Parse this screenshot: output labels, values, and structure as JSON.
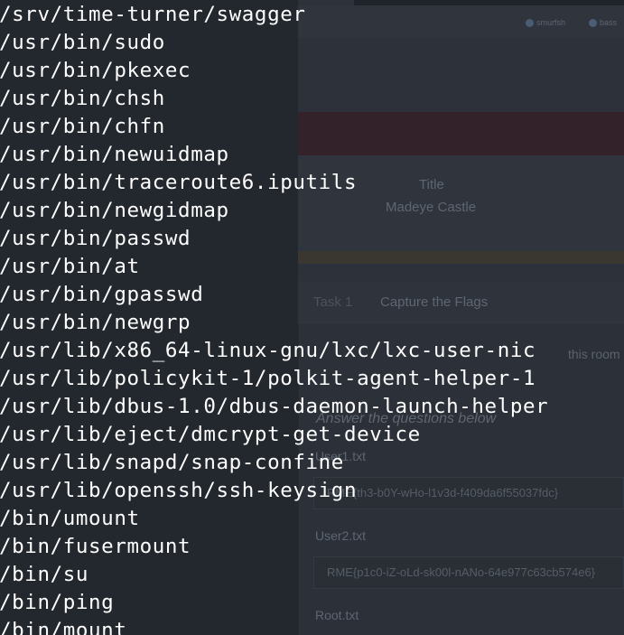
{
  "background_page": {
    "badges": [
      {
        "label": "smurfsh",
        "icon": "profile-dot-icon"
      },
      {
        "label": "bass",
        "icon": "profile-dot-icon"
      }
    ],
    "room_info": {
      "title_label": "Title",
      "title_value": "Madeye Castle"
    },
    "task": {
      "label": "Task 1",
      "title": "Capture the Flags",
      "description": "this room",
      "answers_heading": "Answer the questions below",
      "questions": [
        {
          "label": "User1.txt",
          "answer": "RME{th3-b0Y-wHo-l1v3d-f409da6f55037fdc}"
        },
        {
          "label": "User2.txt",
          "answer": "RME{p1c0-iZ-oLd-sk00l-nANo-64e977c63cb574e6}"
        },
        {
          "label": "Root.txt",
          "answer": ""
        }
      ]
    }
  },
  "terminal": {
    "lines": [
      "/srv/time-turner/swagger",
      "/usr/bin/sudo",
      "/usr/bin/pkexec",
      "/usr/bin/chsh",
      "/usr/bin/chfn",
      "/usr/bin/newuidmap",
      "/usr/bin/traceroute6.iputils",
      "/usr/bin/newgidmap",
      "/usr/bin/passwd",
      "/usr/bin/at",
      "/usr/bin/gpasswd",
      "/usr/bin/newgrp",
      "/usr/lib/x86_64-linux-gnu/lxc/lxc-user-nic",
      "/usr/lib/policykit-1/polkit-agent-helper-1",
      "/usr/lib/dbus-1.0/dbus-daemon-launch-helper",
      "/usr/lib/eject/dmcrypt-get-device",
      "/usr/lib/snapd/snap-confine",
      "/usr/lib/openssh/ssh-keysign",
      "/bin/umount",
      "/bin/fusermount",
      "/bin/su",
      "/bin/ping",
      "/bin/mount"
    ]
  }
}
